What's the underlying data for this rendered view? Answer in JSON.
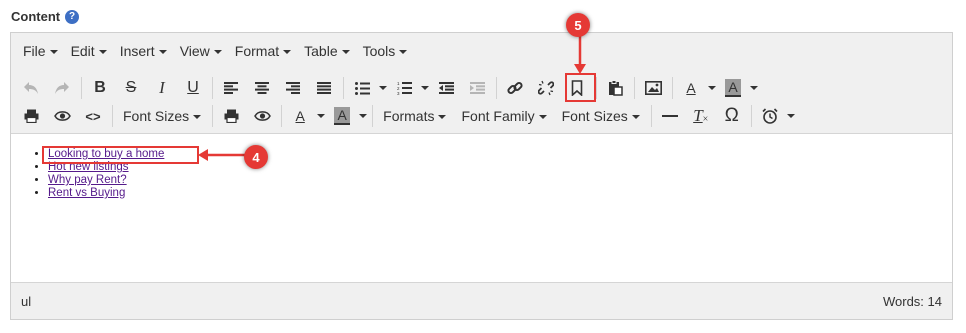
{
  "field": {
    "label": "Content",
    "help_icon": "?"
  },
  "menubar": [
    "File",
    "Edit",
    "Insert",
    "View",
    "Format",
    "Table",
    "Tools"
  ],
  "toolbar": {
    "font_sizes_label": "Font Sizes",
    "formats_label": "Formats",
    "font_family_label": "Font Family",
    "font_sizes_label_2": "Font Sizes",
    "text_color_glyph": "A",
    "bg_color_glyph": "A",
    "bold_glyph": "B",
    "strike_glyph": "S",
    "italic_glyph": "I",
    "underline_glyph": "U",
    "clear_format_glyph": "T",
    "special_char_glyph": "Ω",
    "code_glyph": "<>"
  },
  "content": {
    "links": [
      "Looking to buy a home",
      "Hot new listings",
      "Why pay Rent?",
      "Rent vs Buying"
    ]
  },
  "statusbar": {
    "path": "ul",
    "word_count": "Words: 14"
  },
  "annotations": {
    "badge_4": "4",
    "badge_5": "5",
    "color": "#e53935"
  }
}
